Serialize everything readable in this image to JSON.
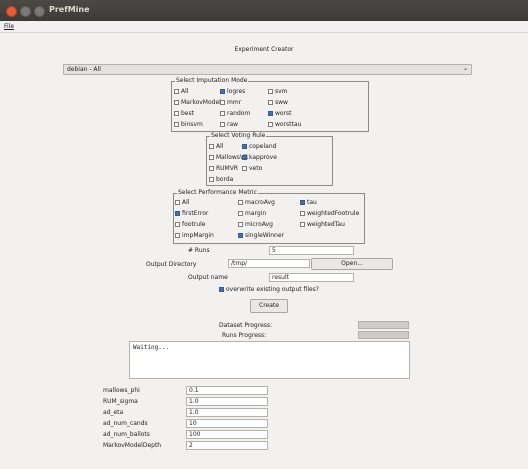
{
  "window": {
    "title": "PrefMine"
  },
  "menu": {
    "file": "File"
  },
  "header": {
    "title": "Experiment Creator"
  },
  "dataset": {
    "selected": "debian - All"
  },
  "imputation": {
    "legend": "Select Imputation Mode",
    "options": [
      {
        "label": "All",
        "checked": false
      },
      {
        "label": "logres",
        "checked": true
      },
      {
        "label": "svm",
        "checked": false
      },
      {
        "label": "MarkovModel",
        "checked": false
      },
      {
        "label": "mmr",
        "checked": false
      },
      {
        "label": "sww",
        "checked": false
      },
      {
        "label": "best",
        "checked": false
      },
      {
        "label": "random",
        "checked": false
      },
      {
        "label": "worst",
        "checked": true
      },
      {
        "label": "binsvm",
        "checked": false
      },
      {
        "label": "raw",
        "checked": false
      },
      {
        "label": "worsttau",
        "checked": false
      }
    ]
  },
  "voting": {
    "legend": "Select Voting Rule",
    "options": [
      {
        "label": "All",
        "checked": false
      },
      {
        "label": "copeland",
        "checked": true
      },
      {
        "label": "MallowsVR",
        "checked": false
      },
      {
        "label": "kapprove",
        "checked": true
      },
      {
        "label": "RUMVR",
        "checked": false
      },
      {
        "label": "veto",
        "checked": false
      },
      {
        "label": "borda",
        "checked": false
      }
    ]
  },
  "metric": {
    "legend": "Select Performance Metric",
    "options": [
      {
        "label": "All",
        "checked": false
      },
      {
        "label": "macroAvg",
        "checked": false
      },
      {
        "label": "tau",
        "checked": true
      },
      {
        "label": "firstError",
        "checked": true
      },
      {
        "label": "margin",
        "checked": false
      },
      {
        "label": "weightedFootrule",
        "checked": false
      },
      {
        "label": "footrule",
        "checked": false
      },
      {
        "label": "microAvg",
        "checked": false
      },
      {
        "label": "weightedTau",
        "checked": false
      },
      {
        "label": "impMargin",
        "checked": false
      },
      {
        "label": "singleWinner",
        "checked": true
      }
    ]
  },
  "runs": {
    "label": "# Runs",
    "value": "5"
  },
  "output_dir": {
    "label": "Output Directory",
    "value": "/tmp/",
    "button": "Open..."
  },
  "output_name": {
    "label": "Output name",
    "value": "result"
  },
  "overwrite": {
    "label": "overwrite existing output files?",
    "checked": true
  },
  "create_button": "Create",
  "progress": {
    "dataset_label": "Dataset Progress:",
    "dataset_value": 0,
    "runs_label": "Runs Progress:",
    "runs_value": 0
  },
  "log": {
    "text": "Waiting..."
  },
  "params": [
    {
      "label": "mallows_phi",
      "value": "0.1"
    },
    {
      "label": "RUM_sigma",
      "value": "1.0"
    },
    {
      "label": "ad_eta",
      "value": "1.0"
    },
    {
      "label": "ad_num_cands",
      "value": "10"
    },
    {
      "label": "ad_num_ballots",
      "value": "100"
    },
    {
      "label": "MarkovModelDepth",
      "value": "2"
    }
  ],
  "colors": {
    "checked": "#4b6eaf",
    "titlebar": "#3c3b37",
    "close": "#e35d32"
  }
}
